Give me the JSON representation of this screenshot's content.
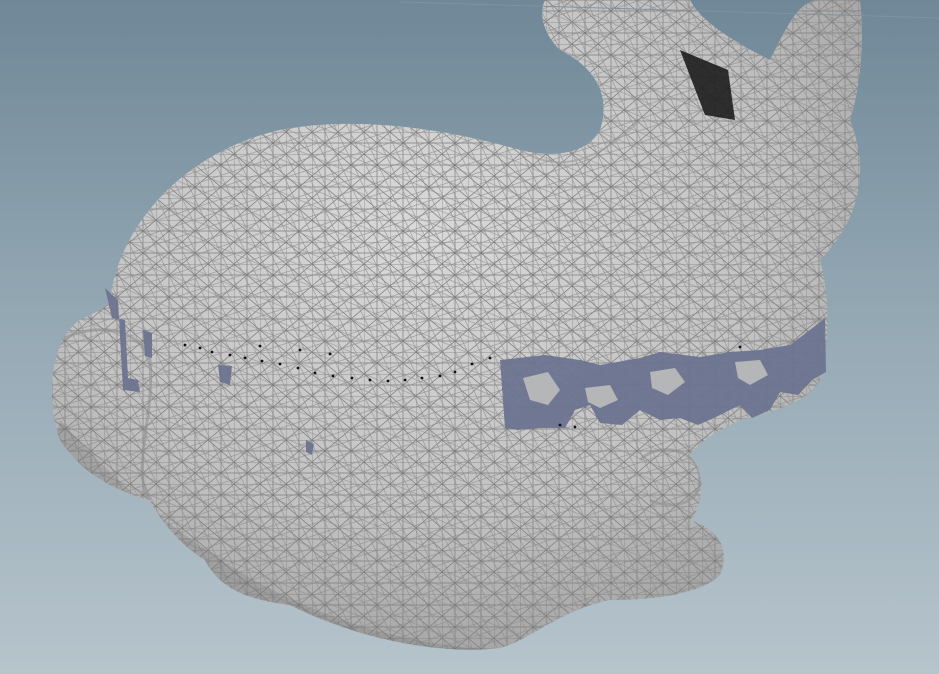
{
  "viewport": {
    "background_top": "#6f8797",
    "background_bottom": "#b6c4cc"
  },
  "model": {
    "mesh_fill": "#c6c6c6",
    "mesh_shadow": "#9c9c9c",
    "wire_color": "#7d7d7d",
    "band_fill": "#6d7490"
  }
}
